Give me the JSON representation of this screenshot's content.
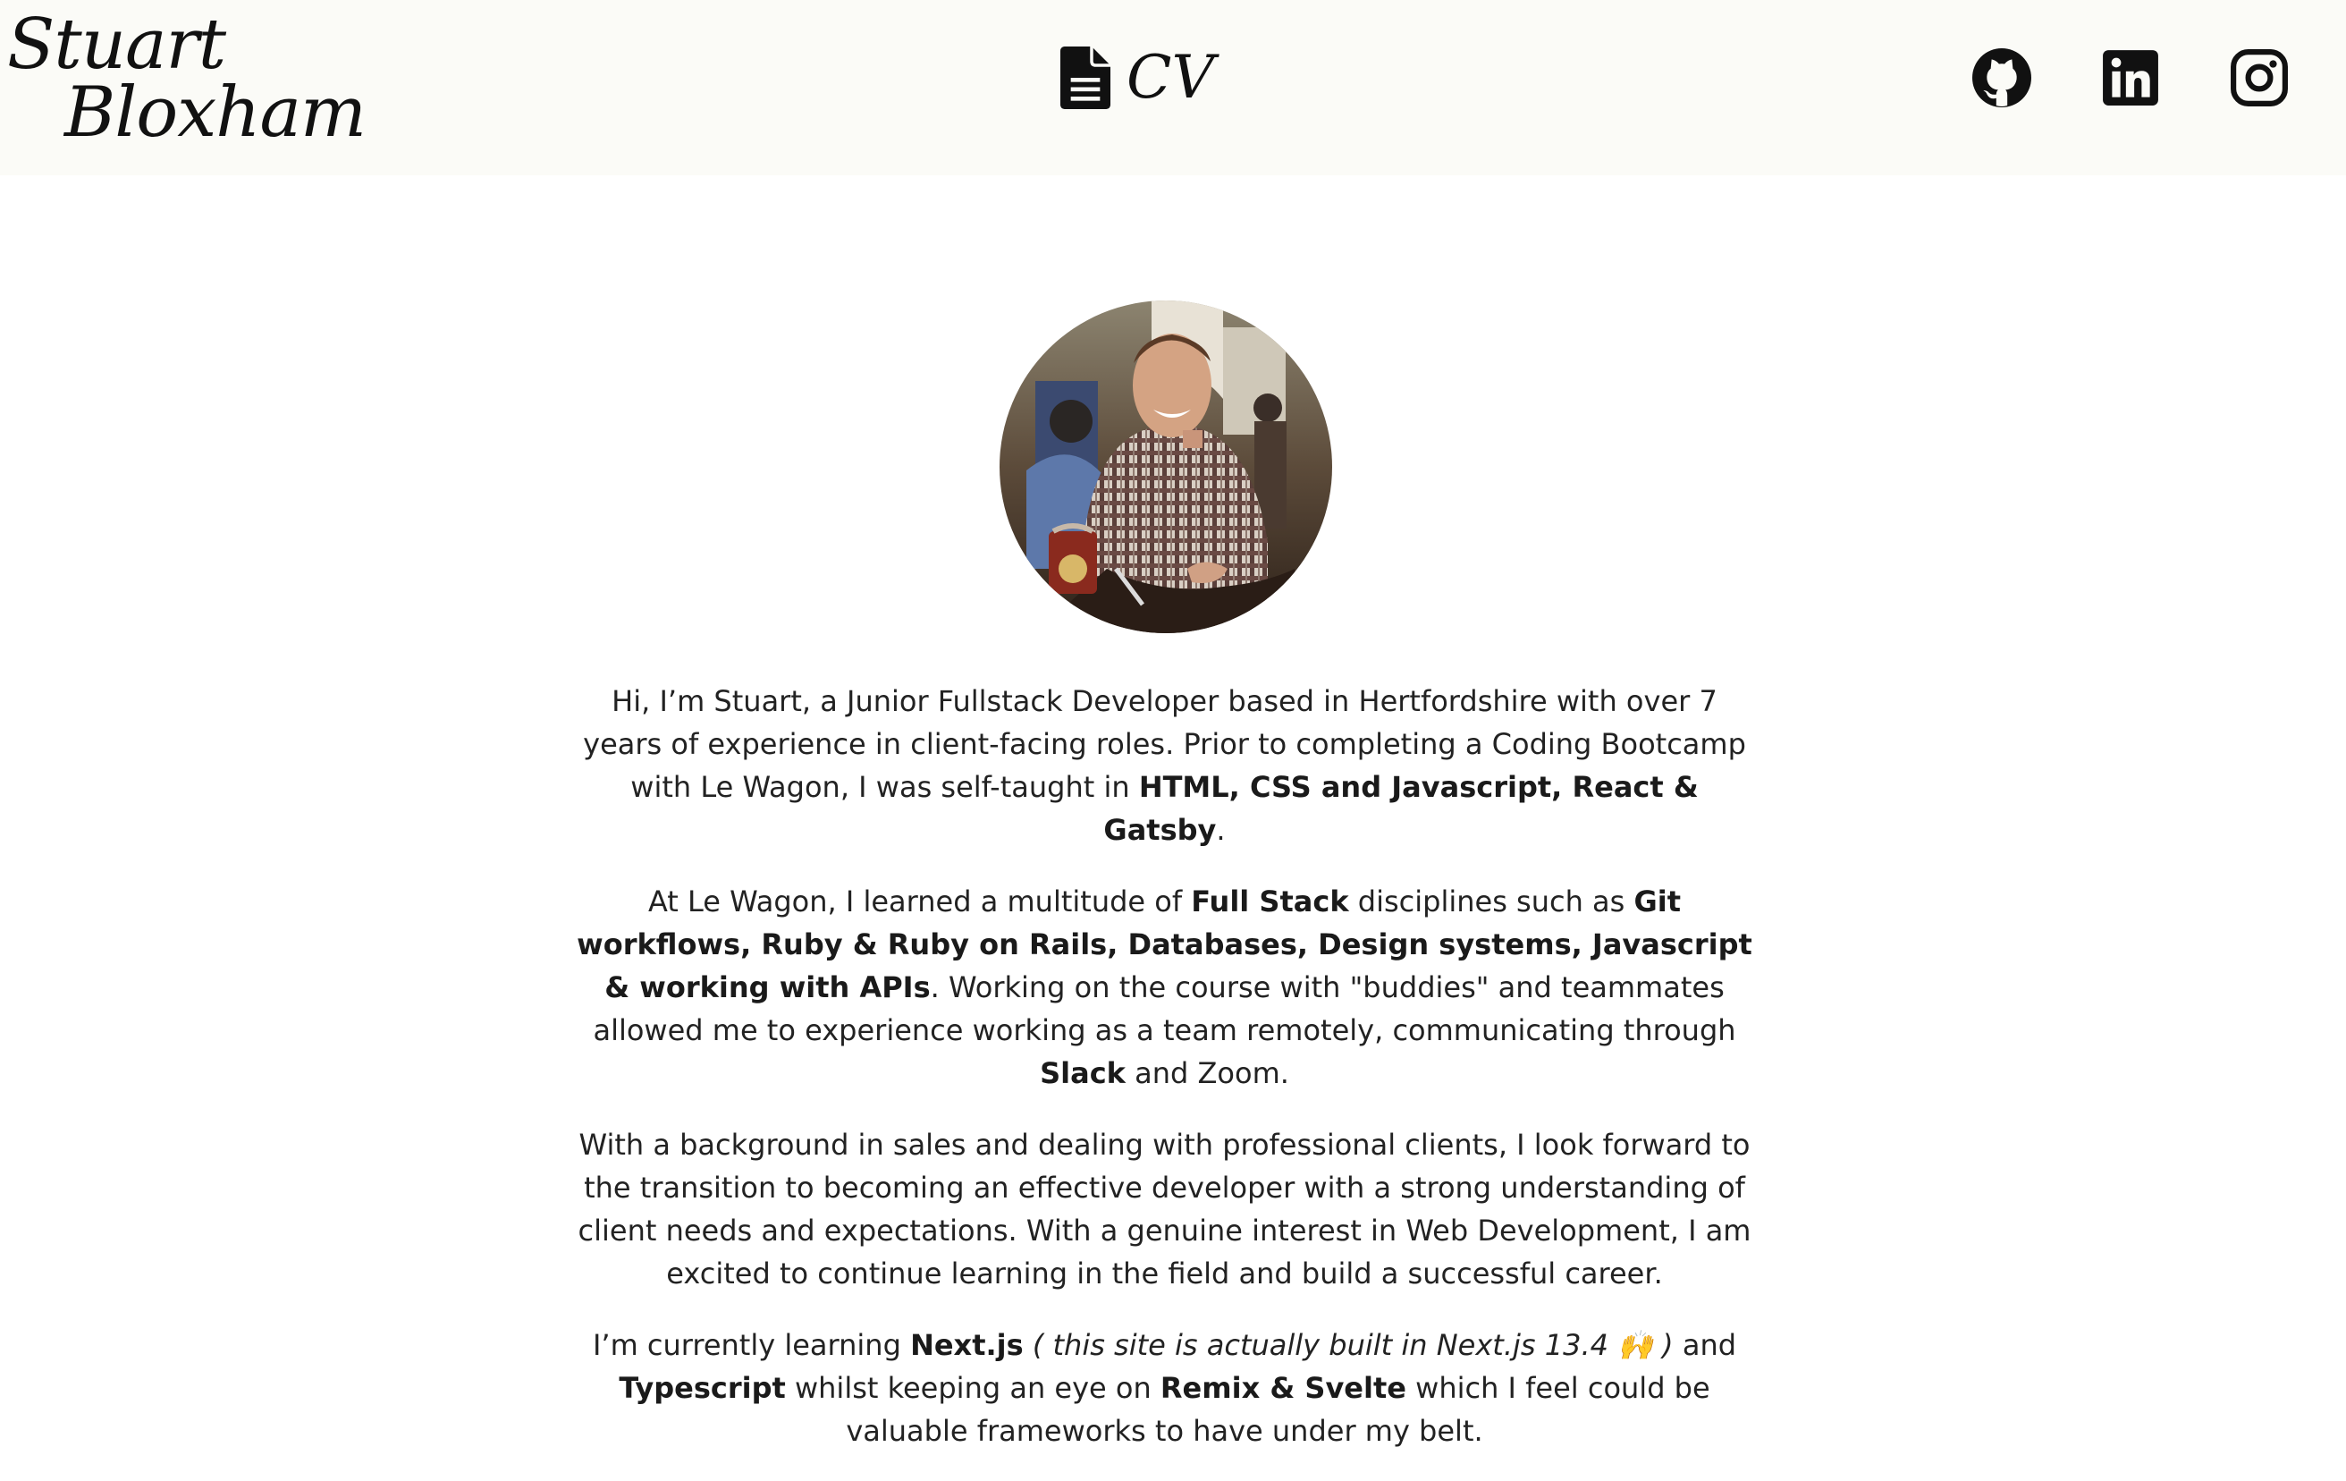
{
  "header": {
    "brand_line1": "Stuart",
    "brand_line2": "Bloxham",
    "cv_label": "CV",
    "cv_icon": "document-icon",
    "social": [
      {
        "name": "github",
        "icon": "github-icon"
      },
      {
        "name": "linkedin",
        "icon": "linkedin-icon"
      },
      {
        "name": "instagram",
        "icon": "instagram-icon"
      }
    ]
  },
  "profile": {
    "avatar": "profile-photo"
  },
  "intro": {
    "p1": {
      "text1": "Hi, I’m Stuart, a Junior Fullstack Developer based in Hertfordshire with over 7 years of experience in client-facing roles. Prior to completing a Coding Bootcamp with Le Wagon, I was self-taught in ",
      "bold1": "HTML, CSS and Javascript, React & Gatsby",
      "text2": "."
    },
    "p2": {
      "text1": "At Le Wagon, I learned a multitude of ",
      "bold1": "Full Stack",
      "text2": " disciplines such as ",
      "bold2": "Git workflows, Ruby & Ruby on Rails, Databases, Design systems, Javascript & working with APIs",
      "text3": ". Working on the course with \"buddies\" and teammates allowed me to experience working as a team remotely, communicating through ",
      "bold3": "Slack",
      "text4": " and Zoom."
    },
    "p3": {
      "text1": "With a background in sales and dealing with professional clients, I look forward to the transition to becoming an effective developer with a strong understanding of client needs and expectations. With a genuine interest in Web Development, I am excited to continue learning in the field and build a successful career."
    },
    "p4": {
      "text1": "I’m currently learning ",
      "bold1": "Next.js",
      "text2": " ",
      "italic1": "( this site is actually built in Next.js 13.4 🙌 )",
      "text3": " and ",
      "bold2": "Typescript",
      "text4": " whilst keeping an eye on ",
      "bold3": "Remix & Svelte",
      "text5": " which I feel could be valuable frameworks to have under my belt."
    }
  }
}
